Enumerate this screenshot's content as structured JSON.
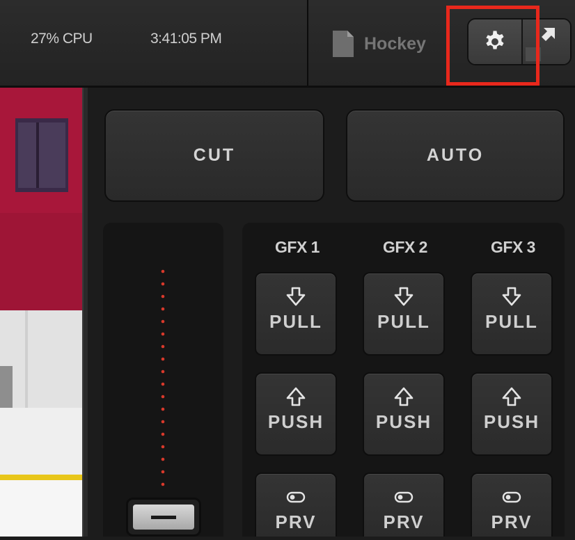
{
  "topbar": {
    "cpu": "27% CPU",
    "time": "3:41:05 PM",
    "document_name": "Hockey",
    "settings_icon": "gear-icon",
    "collapse_icon": "collapse-arrow-icon"
  },
  "switcher": {
    "cut_label": "CUT",
    "auto_label": "AUTO"
  },
  "gfx": {
    "columns": [
      {
        "header": "GFX 1",
        "pull": "PULL",
        "push": "PUSH",
        "prv": "PRV"
      },
      {
        "header": "GFX 2",
        "pull": "PULL",
        "push": "PUSH",
        "prv": "PRV"
      },
      {
        "header": "GFX 3",
        "pull": "PULL",
        "push": "PUSH",
        "prv": "PRV"
      }
    ]
  },
  "colors": {
    "highlight": "#e8281c",
    "tbar_dots": "#d8392b",
    "accent_text": "#d4d4d4"
  }
}
